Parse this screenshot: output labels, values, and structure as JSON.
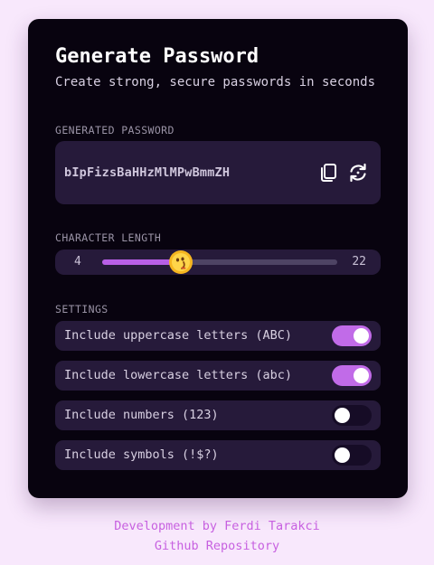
{
  "header": {
    "title": "Generate Password",
    "subtitle": "Create strong, secure passwords in seconds"
  },
  "password": {
    "section_label": "GENERATED PASSWORD",
    "value": "bIpFizsBaHHzMlMPwBmmZH",
    "copy_icon": "copy-icon",
    "refresh_icon": "refresh-icon"
  },
  "length": {
    "section_label": "CHARACTER LENGTH",
    "min": "4",
    "max": "22",
    "current": 10,
    "thumb_icon": "emoji-face-icon"
  },
  "settings": {
    "section_label": "SETTINGS",
    "items": [
      {
        "label": "Include uppercase letters (ABC)",
        "enabled": true
      },
      {
        "label": "Include lowercase letters (abc)",
        "enabled": true
      },
      {
        "label": "Include numbers (123)",
        "enabled": false
      },
      {
        "label": "Include symbols (!$?)",
        "enabled": false
      }
    ]
  },
  "footer": {
    "credit": "Development by Ferdi Tarakci",
    "repo_link": "Github Repository"
  },
  "colors": {
    "page_background": "#f8e8fc",
    "card_background": "#08030f",
    "accent": "#c16be8",
    "footer_text": "#c760e0"
  }
}
